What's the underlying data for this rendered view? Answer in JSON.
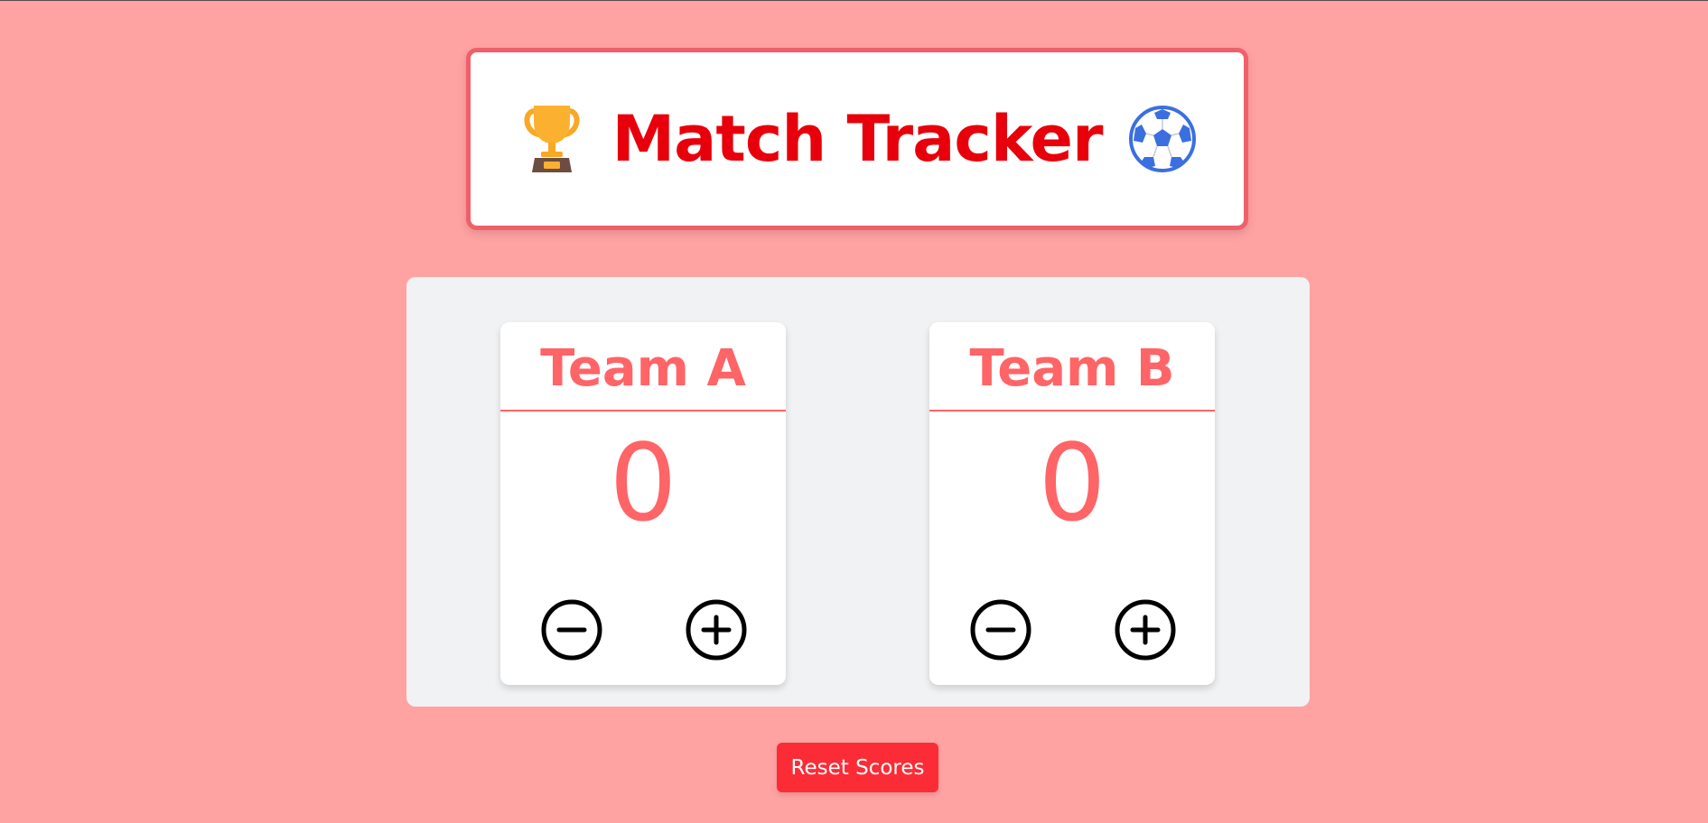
{
  "header": {
    "title": "Match Tracker",
    "left_icon": "trophy-icon",
    "right_icon": "soccer-ball-icon"
  },
  "teams": [
    {
      "name": "Team A",
      "score": "0"
    },
    {
      "name": "Team B",
      "score": "0"
    }
  ],
  "controls": {
    "decrement_icon": "minus-circle-icon",
    "increment_icon": "plus-circle-icon"
  },
  "reset": {
    "label": "Reset Scores"
  },
  "colors": {
    "background": "#ffa2a2",
    "title": "#e7000b",
    "team_accent": "#ff6467",
    "reset_button": "#fb2c36",
    "board": "#f1f2f4"
  }
}
